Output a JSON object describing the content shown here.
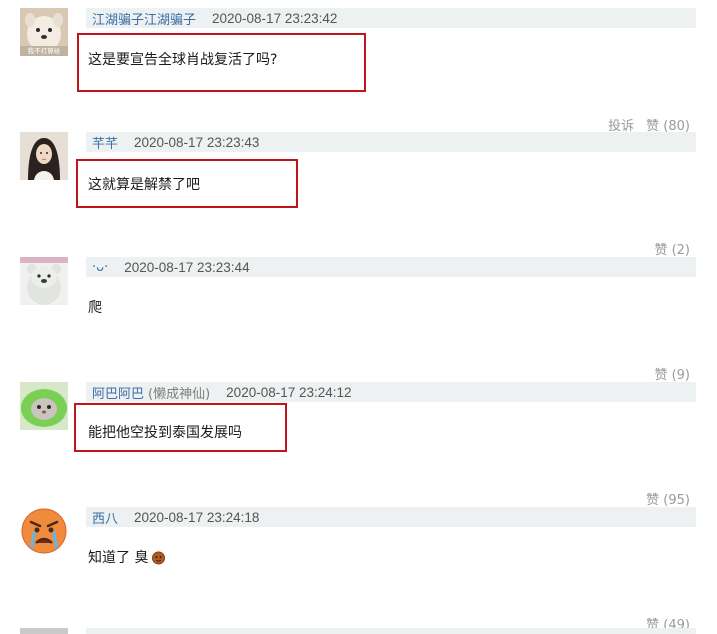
{
  "comments": [
    {
      "username": "江湖骗子江湖骗子",
      "user_suffix": "",
      "user_tag": "",
      "timestamp": "2020-08-17 23:23:42",
      "text": "这是要宣告全球肖战复活了吗?",
      "report_label": "投诉",
      "like_label": "赞 (80)",
      "avatar_icon": "dog-meme-avatar"
    },
    {
      "username": "芊芊",
      "user_suffix": "",
      "user_tag": "",
      "timestamp": "2020-08-17 23:23:43",
      "text": "这就算是解禁了吧",
      "report_label": "",
      "like_label": "赞 (2)",
      "avatar_icon": "girl-portrait-avatar"
    },
    {
      "username": "·ᴗ·",
      "user_suffix": "",
      "user_tag": "",
      "timestamp": "2020-08-17 23:23:44",
      "text": "爬",
      "report_label": "",
      "like_label": "赞 (9)",
      "avatar_icon": "polar-bear-avatar"
    },
    {
      "username": "阿巴阿巴",
      "user_suffix": "",
      "user_tag": "(懒成神仙)",
      "timestamp": "2020-08-17 23:24:12",
      "text": "能把他空投到泰国发展吗",
      "report_label": "",
      "like_label": "赞 (95)",
      "avatar_icon": "cat-in-hood-avatar"
    },
    {
      "username": "西八",
      "user_suffix": "",
      "user_tag": "",
      "timestamp": "2020-08-17 23:24:18",
      "text": "知道了 臭",
      "report_label": "",
      "like_label": "赞 (49)",
      "avatar_icon": "crying-angry-emoji-avatar"
    }
  ],
  "avatar_caption": "我不打算给",
  "colors": {
    "username": "#3a6ea5",
    "header_bg": "#eef1f1",
    "highlight_box": "#c0151a",
    "action_text": "#9a9a9a"
  }
}
